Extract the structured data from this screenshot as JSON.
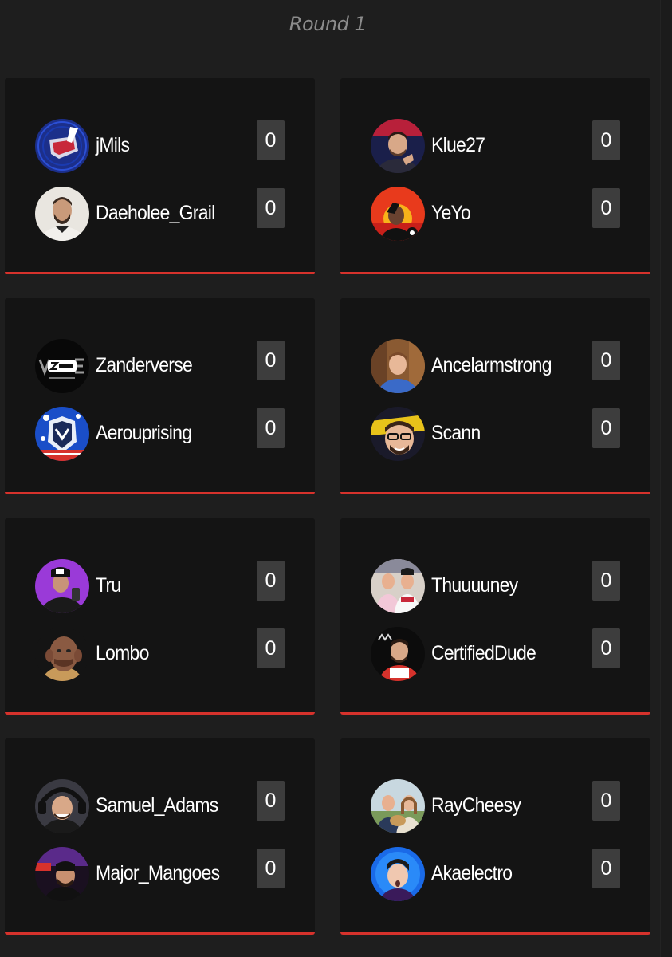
{
  "round": {
    "title": "Round 1"
  },
  "colors": {
    "background": "#1e1e1e",
    "card": "#141414",
    "accent": "#d6322c",
    "score_box": "#3d3d3d",
    "title": "#8c8c8c"
  },
  "matches": [
    {
      "players": [
        {
          "name": "jMils",
          "score": "0",
          "avatar": "jmils-logo-avatar"
        },
        {
          "name": "Daeholee_Grail",
          "score": "0",
          "avatar": "profile-photo-avatar"
        }
      ]
    },
    {
      "players": [
        {
          "name": "Klue27",
          "score": "0",
          "avatar": "profile-photo-avatar"
        },
        {
          "name": "YeYo",
          "score": "0",
          "avatar": "profile-photo-avatar"
        }
      ]
    },
    {
      "players": [
        {
          "name": "Zanderverse",
          "score": "0",
          "avatar": "zander-logo-avatar"
        },
        {
          "name": "Aerouprising",
          "score": "0",
          "avatar": "aero-logo-avatar"
        }
      ]
    },
    {
      "players": [
        {
          "name": "Ancelarmstrong",
          "score": "0",
          "avatar": "profile-photo-avatar"
        },
        {
          "name": "Scann",
          "score": "0",
          "avatar": "profile-photo-avatar"
        }
      ]
    },
    {
      "players": [
        {
          "name": "Tru",
          "score": "0",
          "avatar": "profile-photo-avatar"
        },
        {
          "name": "Lombo",
          "score": "0",
          "avatar": "profile-photo-avatar"
        }
      ]
    },
    {
      "players": [
        {
          "name": "Thuuuuney",
          "score": "0",
          "avatar": "profile-photo-avatar"
        },
        {
          "name": "CertifiedDude",
          "score": "0",
          "avatar": "profile-photo-avatar"
        }
      ]
    },
    {
      "players": [
        {
          "name": "Samuel_Adams",
          "score": "0",
          "avatar": "profile-photo-avatar"
        },
        {
          "name": "Major_Mangoes",
          "score": "0",
          "avatar": "profile-photo-avatar"
        }
      ]
    },
    {
      "players": [
        {
          "name": "RayCheesy",
          "score": "0",
          "avatar": "profile-photo-avatar"
        },
        {
          "name": "Akaelectro",
          "score": "0",
          "avatar": "profile-photo-avatar"
        }
      ]
    }
  ]
}
